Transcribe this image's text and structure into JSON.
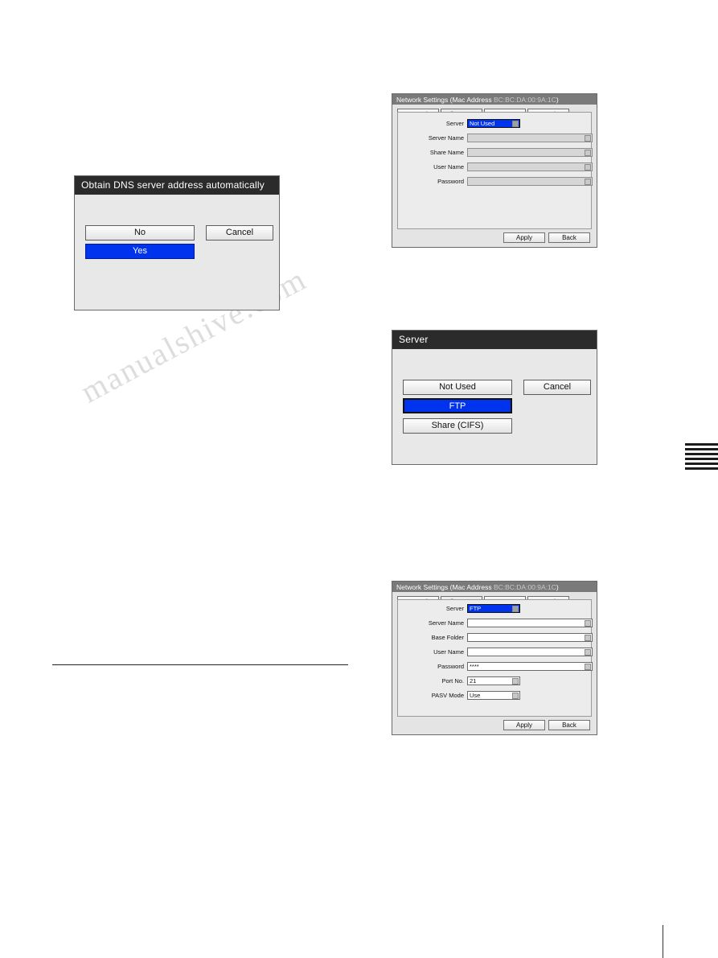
{
  "watermark": {
    "text": "manualshive.com"
  },
  "dns_dialog": {
    "title": "Obtain DNS server address automatically",
    "buttons": {
      "no": "No",
      "cancel": "Cancel",
      "yes": "Yes"
    },
    "selected": "Yes"
  },
  "server_dialog": {
    "title": "Server",
    "buttons": {
      "not_used": "Not Used",
      "cancel": "Cancel",
      "ftp": "FTP",
      "cifs": "Share (CIFS)"
    },
    "selected": "FTP"
  },
  "network_cifs": {
    "title_prefix": "Network Settings (Mac Address ",
    "mac": "BC:BC:DA:00:9A:1C",
    "title_suffix": ")",
    "tabs": [
      "Network",
      "File Server",
      "NTP",
      "Streaming"
    ],
    "active_tab": "File Server",
    "fields": [
      {
        "label": "Server",
        "value": "Not Used",
        "state": "selected",
        "type": "dropdown"
      },
      {
        "label": "Server Name",
        "value": "",
        "state": "disabled",
        "type": "text"
      },
      {
        "label": "Share Name",
        "value": "",
        "state": "disabled",
        "type": "text"
      },
      {
        "label": "User Name",
        "value": "",
        "state": "disabled",
        "type": "text"
      },
      {
        "label": "Password",
        "value": "",
        "state": "disabled",
        "type": "text"
      }
    ],
    "footer": {
      "apply": "Apply",
      "back": "Back"
    }
  },
  "network_ftp": {
    "title_prefix": "Network Settings (Mac Address ",
    "mac": "BC:BC:DA:00:9A:1C",
    "title_suffix": ")",
    "tabs": [
      "Network",
      "File Server",
      "NTP",
      "Streaming"
    ],
    "active_tab": "File Server",
    "fields": [
      {
        "label": "Server",
        "value": "FTP",
        "state": "selected",
        "type": "dropdown"
      },
      {
        "label": "Server Name",
        "value": "",
        "state": "active",
        "type": "text"
      },
      {
        "label": "Base Folder",
        "value": "",
        "state": "active",
        "type": "text"
      },
      {
        "label": "User Name",
        "value": "",
        "state": "active",
        "type": "text"
      },
      {
        "label": "Password",
        "value": "****",
        "state": "active",
        "type": "text"
      },
      {
        "label": "Port No.",
        "value": "21",
        "state": "active",
        "type": "number"
      },
      {
        "label": "PASV Mode",
        "value": "Use",
        "state": "active",
        "type": "dropdown"
      }
    ],
    "footer": {
      "apply": "Apply",
      "back": "Back"
    }
  }
}
